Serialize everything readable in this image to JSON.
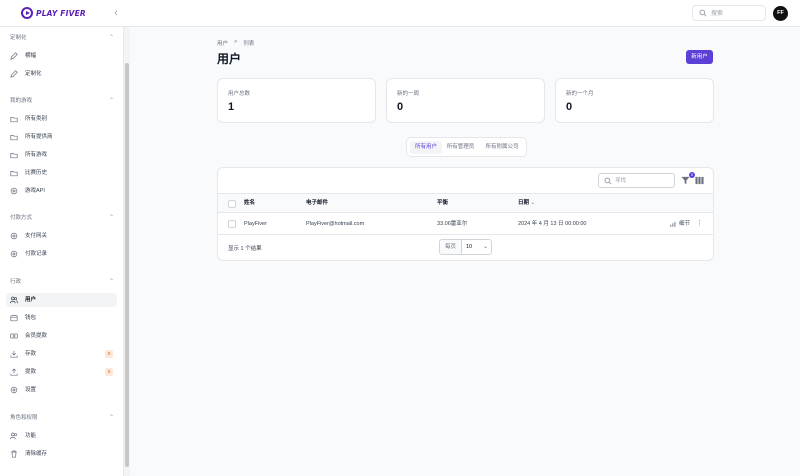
{
  "app": {
    "logo_text": "PLAY FIVER",
    "collapse_glyph": "‹"
  },
  "header": {
    "search_placeholder": "搜索",
    "avatar_initials": "FF"
  },
  "sidebar": {
    "groups": [
      {
        "title": "定制化",
        "items": [
          {
            "label": "横幅",
            "icon": "pen-icon"
          },
          {
            "label": "定制化",
            "icon": "pen-icon"
          }
        ]
      },
      {
        "title": "我的游戏",
        "items": [
          {
            "label": "所有类别",
            "icon": "folder-icon"
          },
          {
            "label": "所有提供商",
            "icon": "folder-icon"
          },
          {
            "label": "所有游戏",
            "icon": "folder-icon"
          },
          {
            "label": "比赛历史",
            "icon": "folder-icon"
          },
          {
            "label": "游戏API",
            "icon": "gear-icon"
          }
        ]
      },
      {
        "title": "付款方式",
        "items": [
          {
            "label": "支付网关",
            "icon": "gear-icon"
          },
          {
            "label": "付款记录",
            "icon": "gear-icon"
          }
        ]
      },
      {
        "title": "行政",
        "items": [
          {
            "label": "用户",
            "icon": "users-icon",
            "active": true
          },
          {
            "label": "钱包",
            "icon": "wallet-icon"
          },
          {
            "label": "会员提款",
            "icon": "money-icon"
          },
          {
            "label": "存款",
            "icon": "download-icon",
            "badge": "0"
          },
          {
            "label": "提款",
            "icon": "upload-icon",
            "badge": "0"
          },
          {
            "label": "设置",
            "icon": "gear-icon"
          }
        ]
      },
      {
        "title": "角色和权限",
        "items": [
          {
            "label": "功能",
            "icon": "users-icon"
          },
          {
            "label": "清除缓存",
            "icon": "trash-icon"
          }
        ]
      }
    ]
  },
  "breadcrumb": [
    "用户",
    ">",
    "列表"
  ],
  "page": {
    "title": "用户",
    "new_button": "新用户"
  },
  "stats": [
    {
      "label": "用户总数",
      "value": "1"
    },
    {
      "label": "新的一周",
      "value": "0"
    },
    {
      "label": "新的一个月",
      "value": "0"
    }
  ],
  "tabs": [
    {
      "label": "所有用户",
      "active": true
    },
    {
      "label": "所有管理员"
    },
    {
      "label": "所有附属公司"
    }
  ],
  "table": {
    "search_placeholder": "寻找",
    "filter_count": "0",
    "columns": [
      "姓名",
      "电子邮件",
      "平衡",
      "日期"
    ],
    "sort_glyph": "⌄",
    "rows": [
      {
        "name": "PlayFiver",
        "email": "PlayFiver@hotmail.com",
        "balance": "33.06雷亚尔",
        "date": "2024 年 4 月 13 日 00:00:00",
        "action": "细节"
      }
    ],
    "summary": "显示 1 个结果",
    "per_page_label": "每页",
    "per_page_value": "10"
  },
  "colors": {
    "accent": "#5b3fd6",
    "badge_bg": "#fde7d9",
    "badge_text": "#ea580c"
  }
}
